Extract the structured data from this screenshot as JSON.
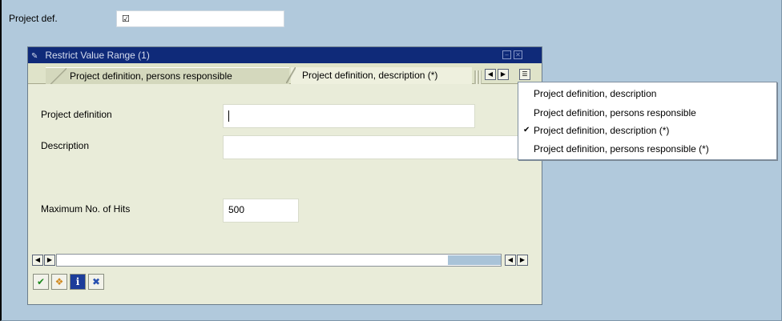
{
  "main": {
    "project_def_label": "Project def.",
    "project_def_value": "☑"
  },
  "dialog": {
    "title": "Restrict Value Range (1)",
    "tabs": [
      {
        "label": "Project definition, persons responsible"
      },
      {
        "label": "Project definition, description (*)"
      }
    ],
    "fields": {
      "project_definition": {
        "label": "Project definition",
        "value": ""
      },
      "description": {
        "label": "Description",
        "value": ""
      },
      "max_hits": {
        "label": "Maximum No. of Hits",
        "value": "500"
      }
    }
  },
  "menu": {
    "items": [
      {
        "label": "Project definition, description",
        "checked": false
      },
      {
        "label": "Project definition, persons responsible",
        "checked": false
      },
      {
        "label": "Project definition, description (*)",
        "checked": true
      },
      {
        "label": "Project definition, persons responsible (*)",
        "checked": false
      }
    ],
    "check_glyph": "✔"
  },
  "icons": {
    "title_icon": "restrict-dialog-icon",
    "scroll_left": "◀",
    "scroll_right": "▶",
    "tab_list": "☰",
    "confirm": "✔",
    "multiple_selection": "❖",
    "info": "i",
    "cancel": "✖",
    "minimize": "‒",
    "close": "✕"
  },
  "colors": {
    "background": "#b1c9dc",
    "titlebar": "#0f2a79",
    "dialog": "#e9ecd9",
    "confirm_green": "#1d8a1d",
    "info_blue": "#1c3d9a",
    "cancel_blue": "#2850b0",
    "multi_orange": "#d08a20"
  }
}
